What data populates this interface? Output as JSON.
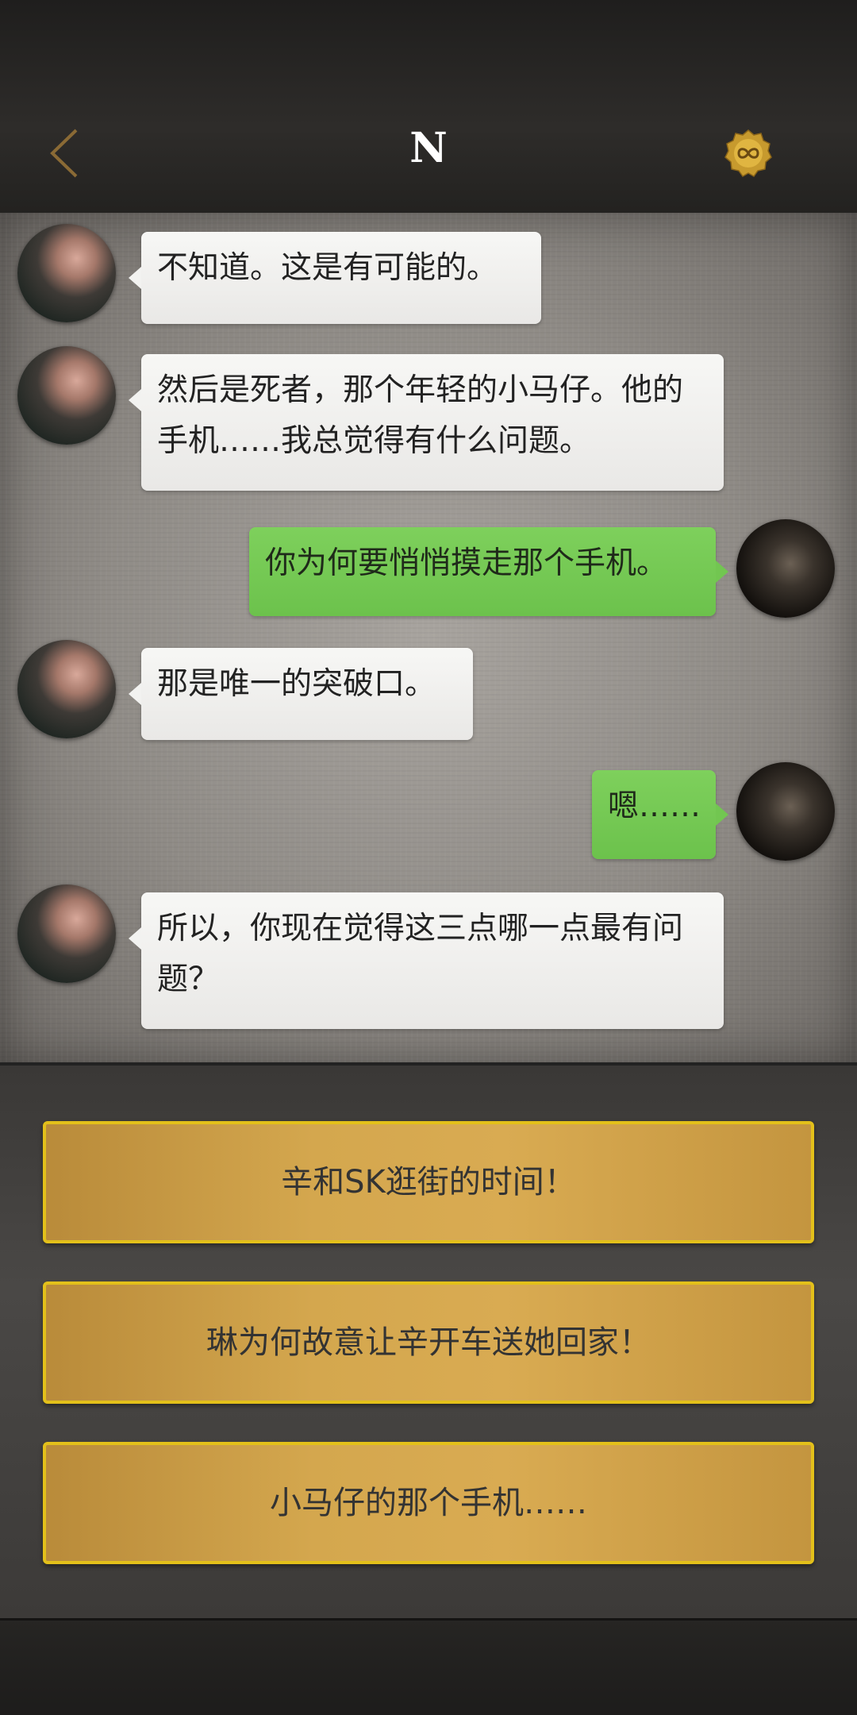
{
  "header": {
    "title": "N",
    "back_icon": "chevron-left-icon",
    "coin_icon": "gold-coin-infinity-icon"
  },
  "messages": [
    {
      "side": "left",
      "text": "不知道。这是有可能的。"
    },
    {
      "side": "left",
      "text": "然后是死者，那个年轻的小马仔。他的手机……我总觉得有什么问题。"
    },
    {
      "side": "right",
      "text": "你为何要悄悄摸走那个手机。"
    },
    {
      "side": "left",
      "text": "那是唯一的突破口。"
    },
    {
      "side": "right",
      "text": "嗯……"
    },
    {
      "side": "left",
      "text": "所以，你现在觉得这三点哪一点最有问题？"
    }
  ],
  "options": [
    {
      "label": "辛和SK逛街的时间！"
    },
    {
      "label": "琳为何故意让辛开车送她回家！"
    },
    {
      "label": "小马仔的那个手机……"
    }
  ],
  "colors": {
    "accent_gold": "#e3c01a",
    "option_fill": "#d4a74e",
    "bubble_green": "#72c651",
    "bubble_white": "#f2f2f0"
  }
}
